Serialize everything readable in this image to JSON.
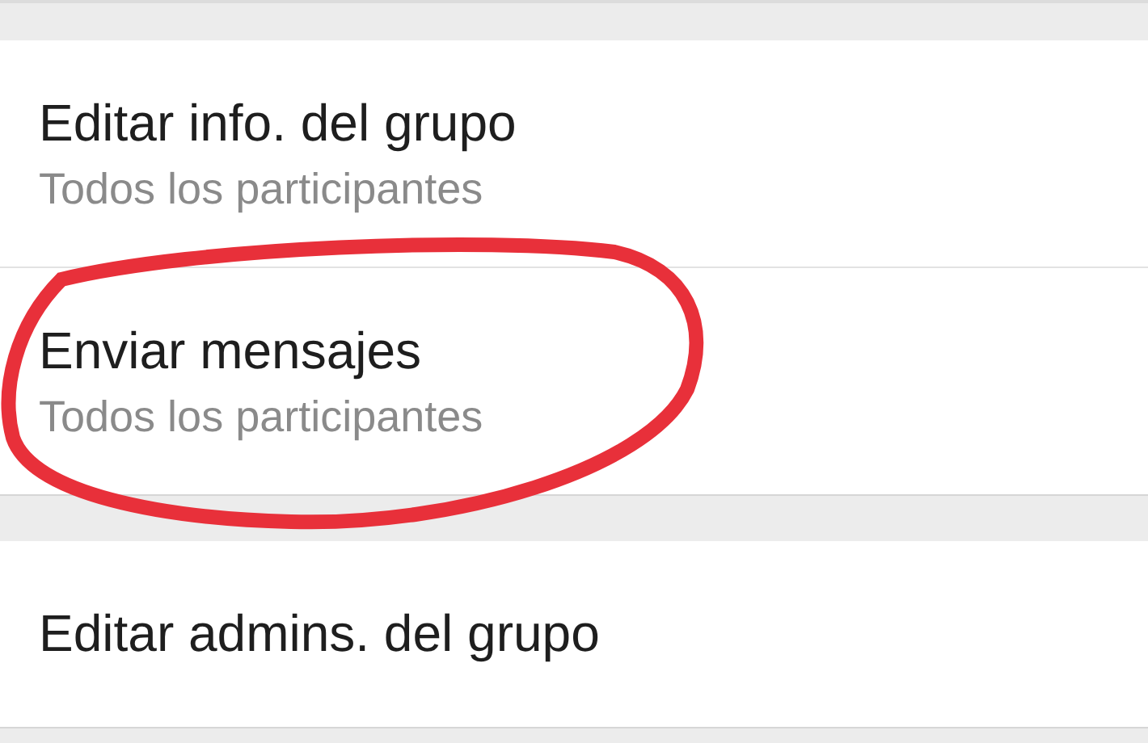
{
  "sections": [
    {
      "items": [
        {
          "title": "Editar info. del grupo",
          "subtitle": "Todos los participantes",
          "circled": false
        },
        {
          "title": "Enviar mensajes",
          "subtitle": "Todos los participantes",
          "circled": true
        }
      ]
    },
    {
      "items": [
        {
          "title": "Editar admins. del grupo",
          "circled": false
        }
      ]
    }
  ]
}
